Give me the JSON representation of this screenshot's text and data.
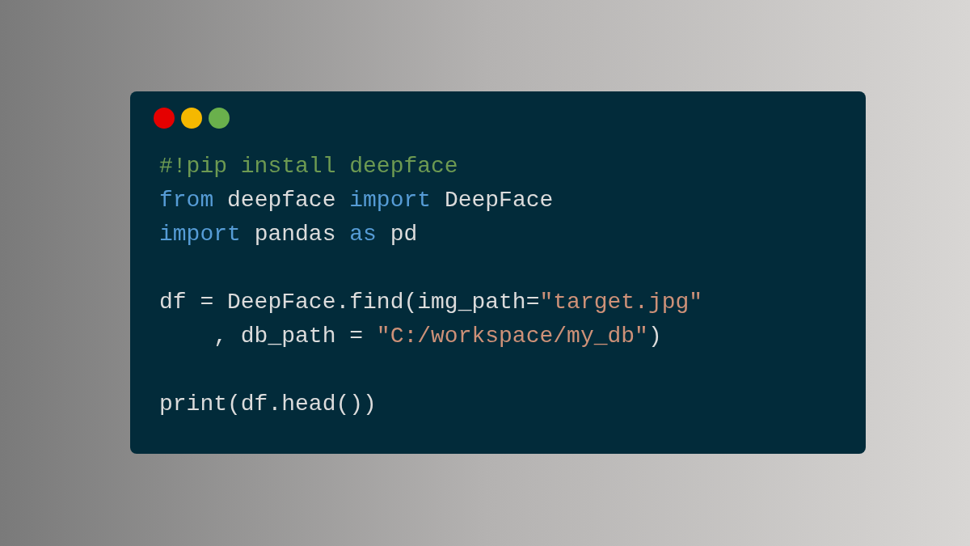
{
  "window_controls": [
    {
      "color": "#e50000"
    },
    {
      "color": "#f5b800"
    },
    {
      "color": "#6ab04c"
    }
  ],
  "code_lines": [
    {
      "kind": "code",
      "tokens": [
        {
          "kind": "comment",
          "text": "#!pip install deepface"
        }
      ]
    },
    {
      "kind": "code",
      "tokens": [
        {
          "kind": "keyword",
          "text": "from"
        },
        {
          "kind": "plain",
          "text": " deepface "
        },
        {
          "kind": "keyword",
          "text": "import"
        },
        {
          "kind": "plain",
          "text": " DeepFace"
        }
      ]
    },
    {
      "kind": "code",
      "tokens": [
        {
          "kind": "keyword",
          "text": "import"
        },
        {
          "kind": "plain",
          "text": " pandas "
        },
        {
          "kind": "keyword",
          "text": "as"
        },
        {
          "kind": "plain",
          "text": " pd"
        }
      ]
    },
    {
      "kind": "blank"
    },
    {
      "kind": "code",
      "tokens": [
        {
          "kind": "plain",
          "text": "df = DeepFace.find(img_path="
        },
        {
          "kind": "string",
          "text": "\"target.jpg\""
        }
      ]
    },
    {
      "kind": "code",
      "tokens": [
        {
          "kind": "plain",
          "text": "    , db_path = "
        },
        {
          "kind": "string",
          "text": "\"C:/workspace/my_db\""
        },
        {
          "kind": "plain",
          "text": ")"
        }
      ]
    },
    {
      "kind": "blank"
    },
    {
      "kind": "code",
      "tokens": [
        {
          "kind": "plain",
          "text": "print(df.head())"
        }
      ]
    }
  ]
}
